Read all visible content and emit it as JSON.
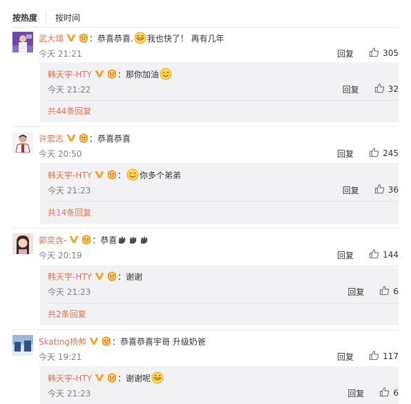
{
  "sort_tabs": {
    "hot": "按热度",
    "time": "按时间"
  },
  "reply_label": "回复",
  "comments": [
    {
      "user": "武大靖",
      "text_a": "：恭喜恭喜.",
      "text_b": "我也快了！  再有几年",
      "time": "今天 21:21",
      "likes": "305",
      "reply": {
        "user": "韩天宇-HTY",
        "text": "：那你加油",
        "time": "今天 21:22",
        "likes": "32"
      },
      "more": "共44条回复"
    },
    {
      "user": "许宏志",
      "text_a": "：恭喜恭喜",
      "time": "今天 20:50",
      "likes": "245",
      "reply": {
        "user": "韩天宇-HTY",
        "text": "：",
        "text_b": "你多个弟弟",
        "time": "今天 21:23",
        "likes": "36"
      },
      "more": "共14条回复"
    },
    {
      "user": "郭奕含-",
      "text_a": "：恭喜",
      "time": "今天 20:19",
      "likes": "144",
      "reply": {
        "user": "韩天宇-HTY",
        "text": "：谢谢",
        "time": "今天 21:23",
        "likes": "6"
      },
      "more": "共2条回复"
    },
    {
      "user": "Skating杨帅",
      "text_a": "：恭喜恭喜宇哥 升级奶爸",
      "time": "今天 19:21",
      "likes": "117",
      "reply": {
        "user": "韩天宇-HTY",
        "text": "：谢谢呢",
        "time": "今天 21:23",
        "likes": "6"
      }
    }
  ],
  "colors": {
    "username": "#eb7350",
    "verified": "#f5a623",
    "reply_bg": "#f2f2f5",
    "time": "#808080"
  },
  "icons": [
    "verified-v-icon",
    "level-badge-icon",
    "grin-emoji-icon",
    "smile-emoji-icon",
    "clap-emoji-icon",
    "thumbs-up-icon"
  ]
}
